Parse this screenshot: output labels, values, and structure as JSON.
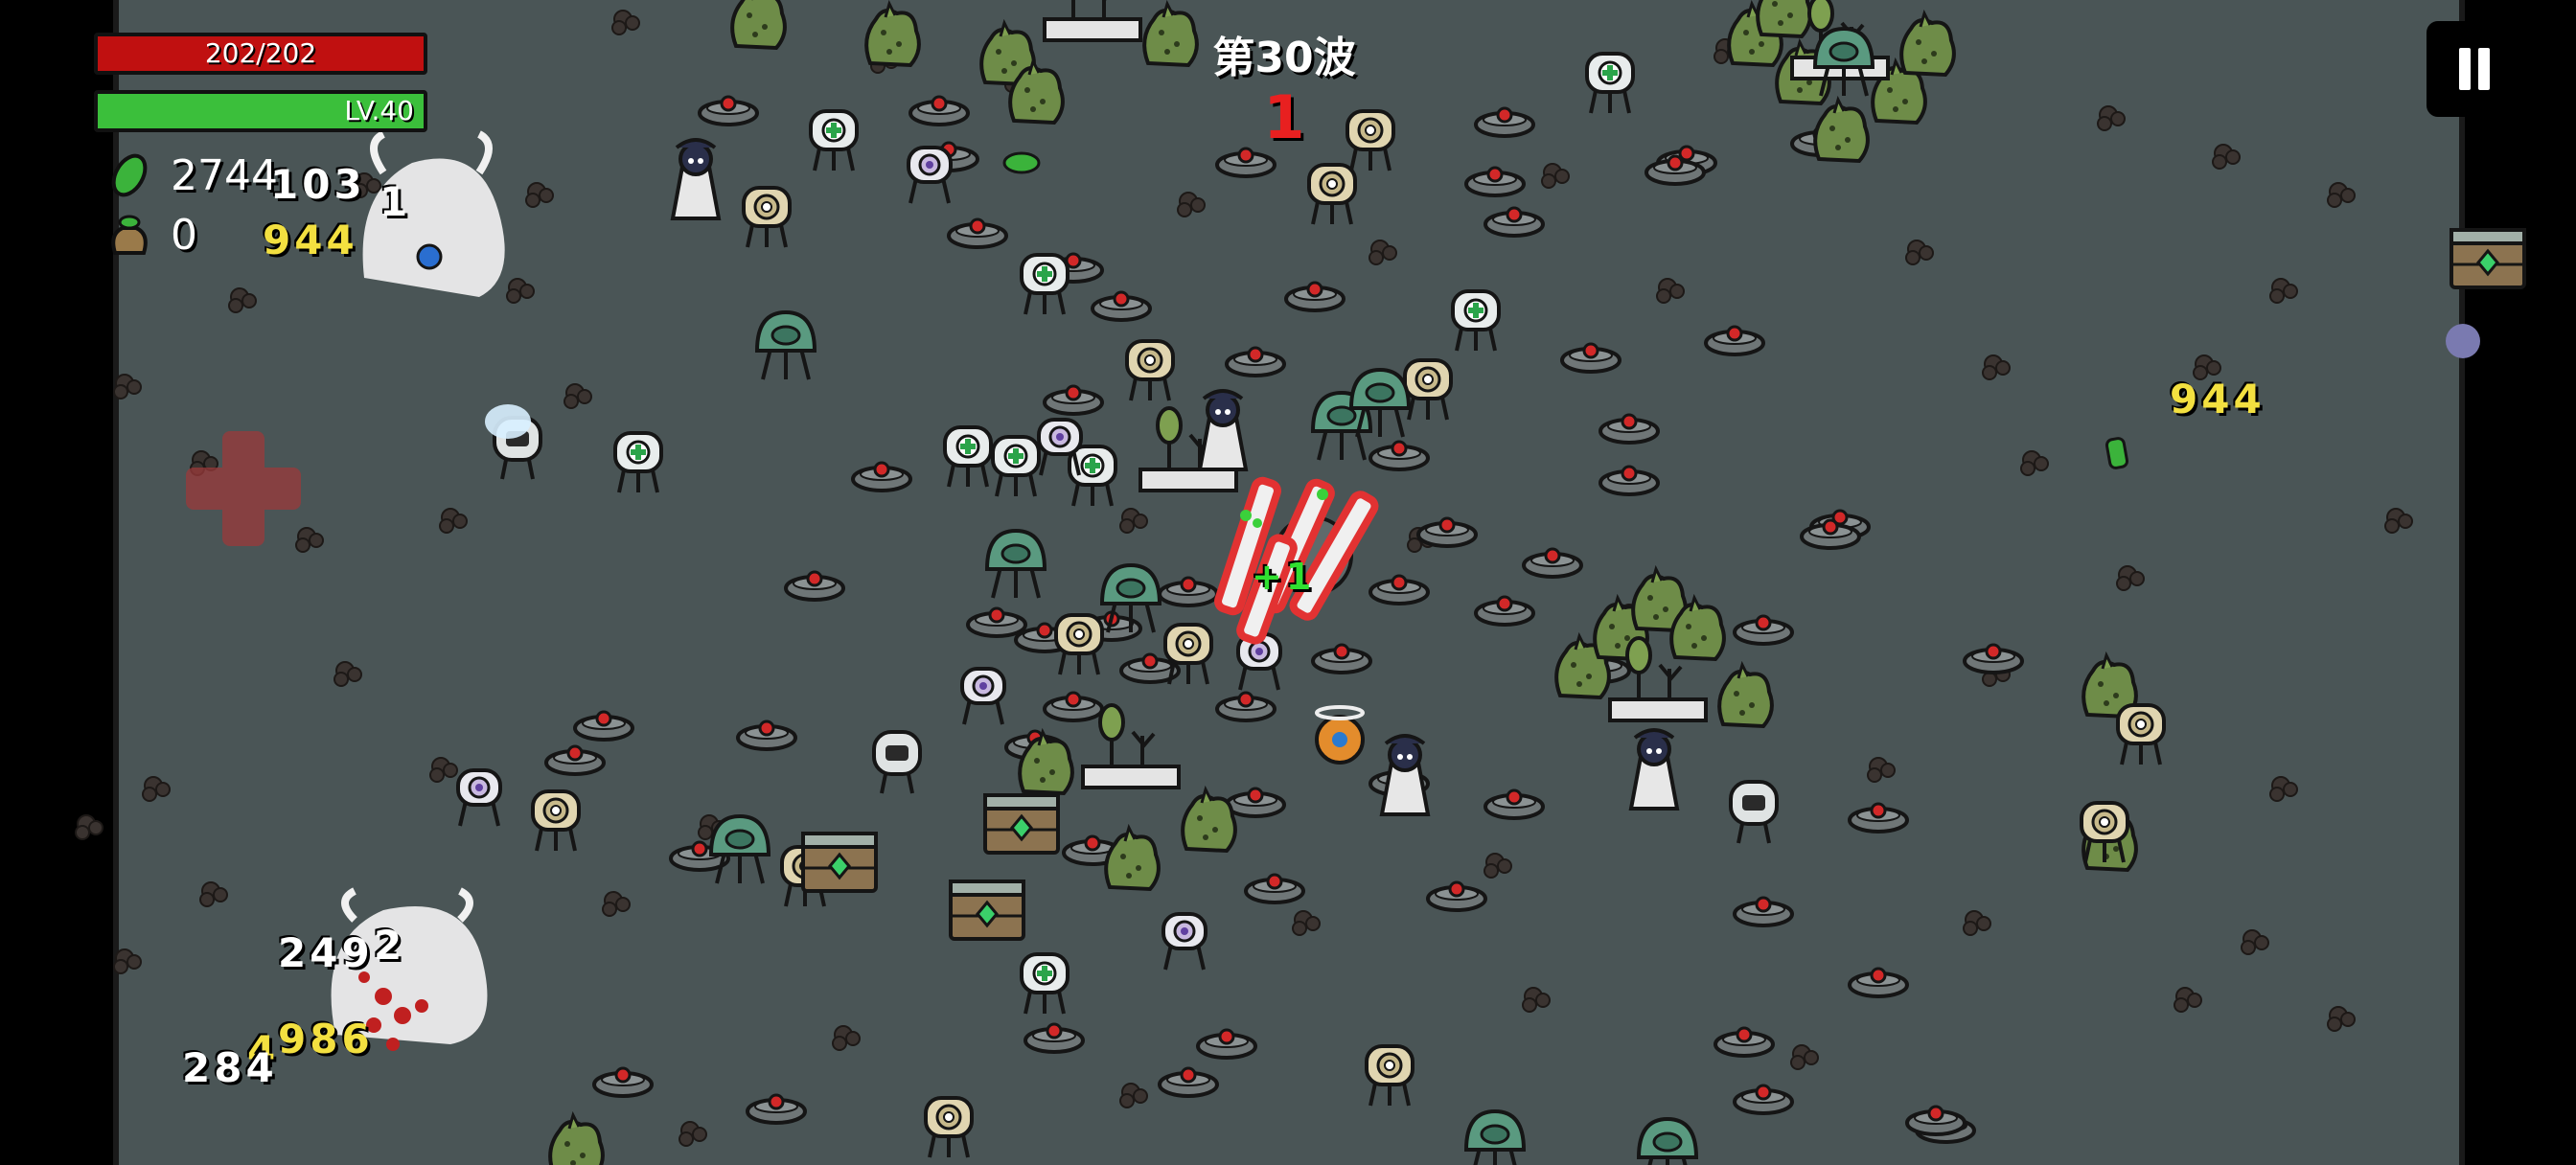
{
  "hud": {
    "hp_text": "202/202",
    "hp_fraction": 1.0,
    "level_text": "LV.40",
    "xp_fraction": 1.0,
    "materials": "2744",
    "bag": "0",
    "wave_title": "第30波",
    "wave_timer": "1",
    "pause_icon": "pause-icon"
  },
  "popups": {
    "p1": "103",
    "p2": "1",
    "p3": "944",
    "p4": "944",
    "p5": "249",
    "p6": "2",
    "p7": "4",
    "p8": "986",
    "p9": "284",
    "p10": "+1"
  },
  "colors": {
    "ground": "#4a5556",
    "hp": "#c01010",
    "xp": "#3bbf3b",
    "timer": "#e82020",
    "damage": "#f3e040"
  }
}
